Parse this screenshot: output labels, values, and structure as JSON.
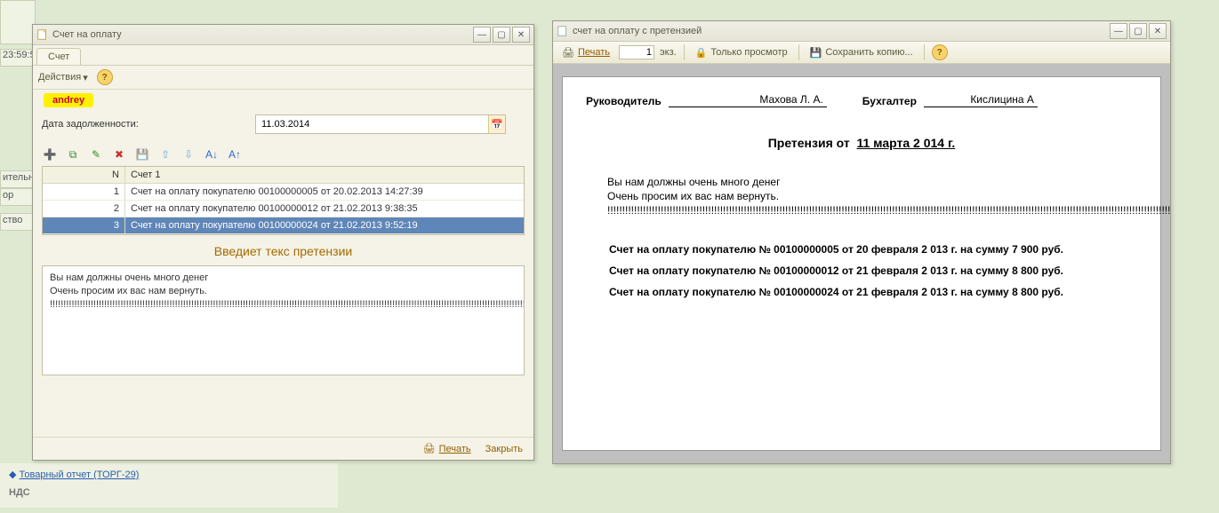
{
  "left": {
    "title": "Счет на оплату",
    "tab_label": "Счет",
    "actions_label": "Действия",
    "user_tag": "andrey",
    "date_label": "Дата задолженности:",
    "date_value": "11.03.2014",
    "grid_headers": {
      "n": "N",
      "c": "Счет 1"
    },
    "rows": [
      {
        "n": "1",
        "c": "Счет на оплату покупателю 00100000005 от 20.02.2013 14:27:39",
        "sel": false
      },
      {
        "n": "2",
        "c": "Счет на оплату покупателю 00100000012 от 21.02.2013 9:38:35",
        "sel": false
      },
      {
        "n": "3",
        "c": "Счет на оплату покупателю 00100000024 от 21.02.2013 9:52:19",
        "sel": true
      }
    ],
    "section_title": "Введиет текс претензии",
    "claim_text": "Вы нам должны очень много денег\nОчень просим их вас нам вернуть.\n!!!!!!!!!!!!!!!!!!!!!!!!!!!!!!!!!!!!!!!!!!!!!!!!!!!!!!!!!!!!!!!!!!!!!!!!!!!!!!!!!!!!!!!!!!!!!!!!!!!!!!!!!!!!!!!!!!!!!!!!!!!!!!!!!!!!!!!!!!!!!!!!!!!!!!!!!!!!!!!!!!!!!!!!!!!!!!!!!!!!!!!!!!!!!!!!!!!!!!!!!!!!!!!!!!!!!!!!!!!!!!!!!!!!!!!!!!!!!!!!!!!!!!!!!!!!!!!!!!!!!!!!!!!!!!!!!!!!!!!!!!!!!!!!!!!!!!!!!!!!!!!!!!!!!!!!!!!!!!!!!!!!!!!!!!!!!!!!",
    "footer": {
      "print": "Печать",
      "close": "Закрыть"
    }
  },
  "right": {
    "title": "счет на оплату с претензией",
    "toolbar": {
      "print": "Печать",
      "copies": "1",
      "copies_suffix": "экз.",
      "view_only": "Только просмотр",
      "save_copy": "Сохранить копию..."
    },
    "doc": {
      "role_head": "Руководитель",
      "head_name": "Махова Л. А.",
      "role_acc": "Бухгалтер",
      "acc_name": "Кислицина А",
      "claim_title_prefix": "Претензия от",
      "claim_title_date": "11 марта 2 014 г.",
      "claim_body": "Вы нам должны очень много денег\nОчень просим их вас нам вернуть.\n!!!!!!!!!!!!!!!!!!!!!!!!!!!!!!!!!!!!!!!!!!!!!!!!!!!!!!!!!!!!!!!!!!!!!!!!!!!!!!!!!!!!!!!!!!!!!!!!!!!!!!!!!!!!!!!!!!!!!!!!!!!!!!!!!!!!!!!!!!!!!!!!!!!!!!!!!!!!!!!!!!!!!!!!!!!!!!!!!!!!!!!!!!!!!!!!!!!!!!!!!!!!!!!!!!!!!!!!!!!!!!!!!!!!!!!!!!!!!!!!!!!!!!!!!!!!!!!!!!!!!!!!!!!!!!!!!!!!!!!!!!!!!!!!!!!!!!!!!!!!!!!!!!!!!!!!!!!!!!!!!!!!!!!!!!!!!!!!!!!!!!!!!!!!!!!!!!!!!!!!!!!!!!!!!!!!!!!!!!!!!!!!!!!!!!!!!!!!!!!!!!!!!!!!!!!!!!!!!!!!!!!!!!!!!!!!!!!!!!!!!!!!!!!!!!!!!!",
      "invoices": [
        "Счет на оплату покупателю № 00100000005 от 20 февраля 2 013 г. на сумму 7 900 руб.",
        "Счет на оплату покупателю № 00100000012 от 21 февраля 2 013 г. на сумму 8 800 руб.",
        "Счет на оплату покупателю № 00100000024 от 21 февраля 2 013 г. на сумму 8 800 руб."
      ]
    }
  },
  "bg": {
    "left_frag1": "ительн",
    "left_frag2": "ор",
    "left_frag3": "ство",
    "time": "23:59:5",
    "link_torg": "Товарный отчет (ТОРГ-29)",
    "nds": "НДС"
  }
}
